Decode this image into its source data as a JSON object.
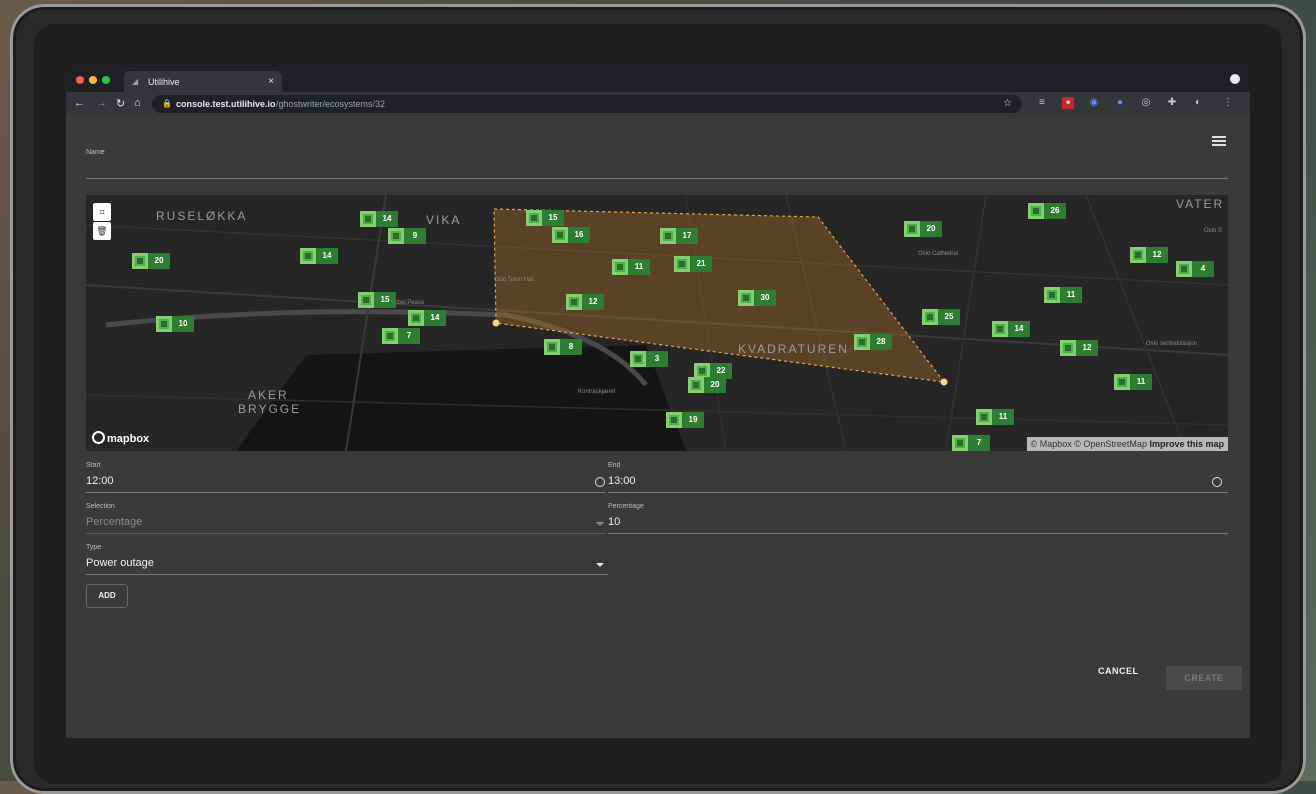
{
  "browser": {
    "tab_title": "Utilihive",
    "tab_close": "×",
    "url_host": "console.test.utilihive.io",
    "url_path": "/ghostwriter/ecosystems/32",
    "icons": [
      "back-arrow-icon",
      "forward-arrow-icon",
      "reload-icon",
      "home-icon",
      "lock-icon",
      "bookmark-star-icon"
    ]
  },
  "form": {
    "name_label": "Name",
    "name_value": "",
    "start_label": "Start",
    "start_value": "12:00",
    "end_label": "End",
    "end_value": "13:00",
    "selection_label": "Selection",
    "selection_placeholder": "Percentage",
    "percentage_label": "Percentage",
    "percentage_value": "10",
    "type_label": "Type",
    "type_value": "Power outage",
    "add_label": "ADD",
    "cancel_label": "CANCEL",
    "create_label": "CREATE"
  },
  "map": {
    "places": [
      "RUSELØKKA",
      "VIKA",
      "VATER",
      "AKER",
      "BRYGGE",
      "KVADRATUREN"
    ],
    "small_places": [
      "Oslo Town Hall",
      "Nobel Peace",
      "Oslo Cathedral",
      "Kontraskjæret",
      "Oslo sentralstasjon",
      "Oslo S"
    ],
    "attribution_text": "© Mapbox © OpenStreetMap",
    "attribution_link": "Improve this map",
    "logo_text": "mapbox",
    "markers": [
      "14",
      "9",
      "20",
      "14",
      "15",
      "16",
      "17",
      "11",
      "21",
      "12",
      "30",
      "20",
      "26",
      "12",
      "4",
      "11",
      "25",
      "14",
      "12",
      "28",
      "15",
      "14",
      "7",
      "10",
      "8",
      "3",
      "22",
      "20",
      "11",
      "19",
      "11",
      "7"
    ]
  },
  "colors": {
    "marker_green": "#4caf50",
    "polygon_stroke": "#e6a64a",
    "create_disabled": "#4a4a4a"
  }
}
